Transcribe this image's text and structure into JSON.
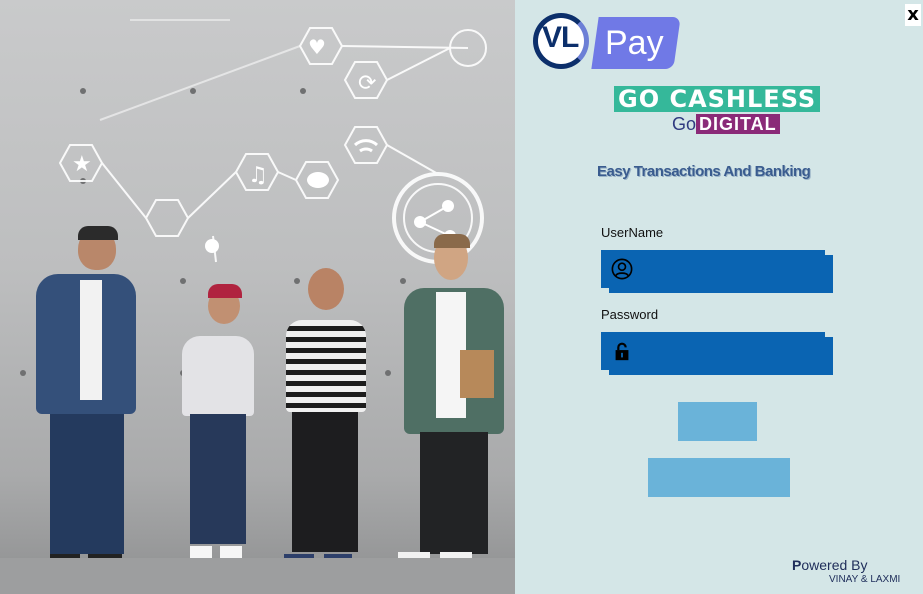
{
  "window": {
    "close_label": "x"
  },
  "brand": {
    "logo_left": "VL",
    "logo_right": "Pay",
    "slogan_primary": "GO CASHLESS",
    "slogan_secondary_go": "Go",
    "slogan_secondary_digital": "DIGITAL",
    "tagline": "Easy Transactions And Banking"
  },
  "form": {
    "username_label": "UserName",
    "username_value": "",
    "username_icon": "user-circle-icon",
    "password_label": "Password",
    "password_value": "",
    "password_icon": "padlock-icon",
    "login_button_label": "",
    "second_button_label": ""
  },
  "footer": {
    "powered_first": "P",
    "powered_rest": "owered By",
    "company": "VINAY & LAXMI"
  },
  "colors": {
    "panel_bg": "#d4e6e7",
    "field_bg": "#0a64b2",
    "button_bg": "#6ab3d9",
    "logo_navy": "#0c2f6b",
    "logo_purple": "#7079e6",
    "cashless_green": "#35b89a",
    "digital_plum": "#8a2a78"
  }
}
